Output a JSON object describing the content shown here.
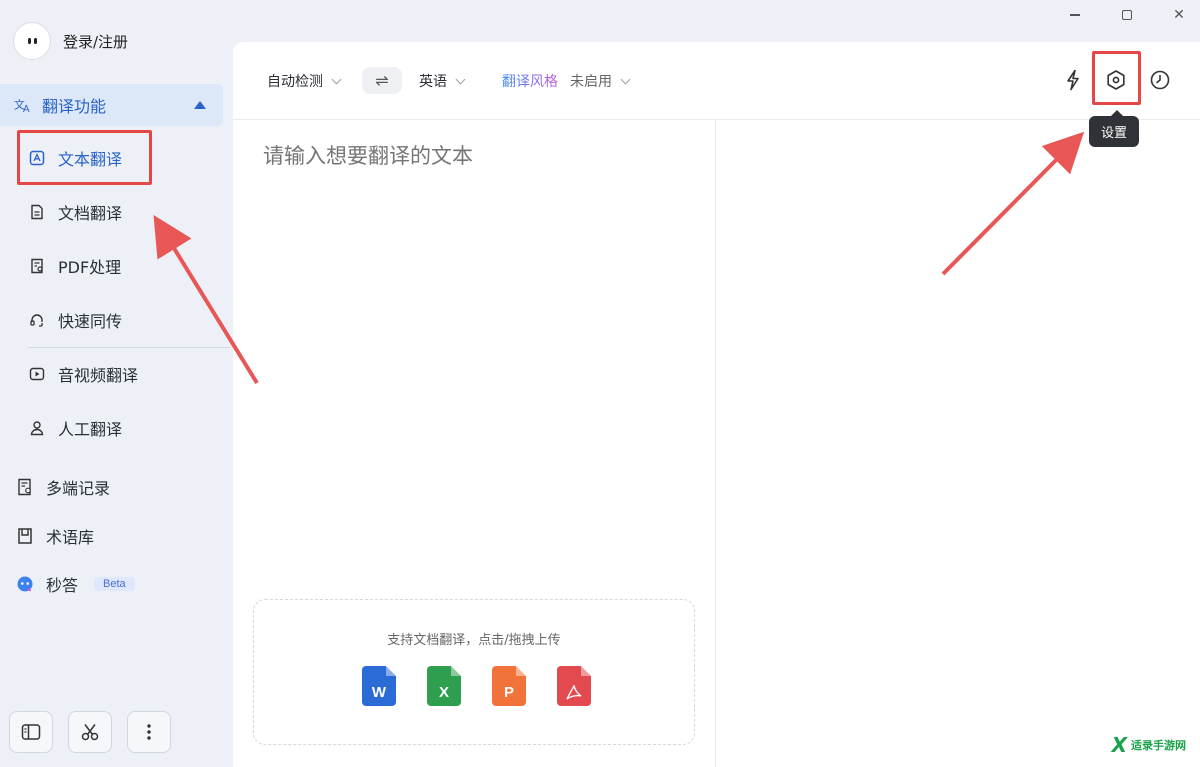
{
  "window": {
    "minimize_icon": "minimize-icon",
    "maximize_icon": "maximize-icon",
    "close_glyph": "✕"
  },
  "user": {
    "login_label": "登录/注册"
  },
  "sidebar": {
    "group": {
      "label": "翻译功能",
      "icon": "translate-icon"
    },
    "sub_items": [
      {
        "label": "文本翻译",
        "icon": "text-translate-icon",
        "active": true
      },
      {
        "label": "文档翻译",
        "icon": "document-icon"
      },
      {
        "label": "PDF处理",
        "icon": "pdf-icon"
      },
      {
        "label": "快速同传",
        "icon": "headset-icon"
      },
      {
        "label": "音视频翻译",
        "icon": "video-icon"
      },
      {
        "label": "人工翻译",
        "icon": "person-icon"
      }
    ],
    "top_items": [
      {
        "label": "多端记录",
        "icon": "records-icon"
      },
      {
        "label": "术语库",
        "icon": "book-icon"
      },
      {
        "label": "秒答",
        "icon": "ai-bot-icon",
        "badge": "Beta"
      }
    ],
    "bottom_buttons": [
      "sidebar-toggle-icon",
      "scissors-icon",
      "more-vertical-icon"
    ]
  },
  "toolbar": {
    "source_lang": "自动检测",
    "swap_glyph": "⇌",
    "target_lang": "英语",
    "style_label": "翻译风格",
    "style_value": "未启用",
    "icons": [
      "lightning-icon",
      "settings-icon",
      "history-icon"
    ],
    "tooltip": "设置"
  },
  "editor": {
    "placeholder": "请输入想要翻译的文本"
  },
  "drop_zone": {
    "text": "支持文档翻译，点击/拖拽上传",
    "files": [
      {
        "letter": "W",
        "color": "#2b6bd6",
        "type": "word"
      },
      {
        "letter": "X",
        "color": "#2e9e4f",
        "type": "excel"
      },
      {
        "letter": "P",
        "color": "#f2733a",
        "type": "powerpoint"
      },
      {
        "letter": "",
        "color": "#e34a4f",
        "type": "pdf"
      }
    ]
  },
  "watermark": {
    "text": "适录手游网"
  },
  "colors": {
    "accent": "#2a63c9",
    "highlight": "#e54646",
    "active_bg": "#dce7f7"
  }
}
